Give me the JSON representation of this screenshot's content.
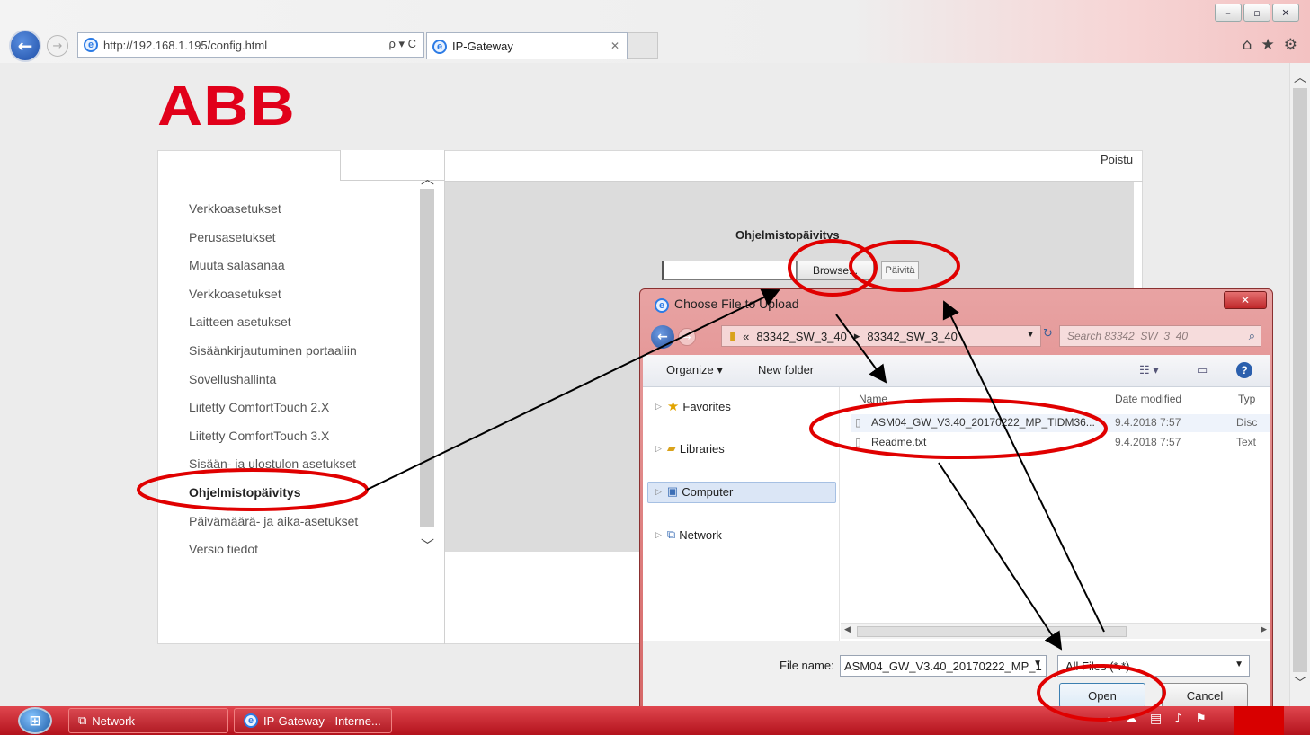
{
  "browser": {
    "url": "http://192.168.1.195/config.html",
    "tab_title": "IP-Gateway",
    "addr_tools": "ρ ▾ C",
    "win_controls": [
      "–",
      "▫",
      "✕"
    ]
  },
  "page": {
    "logo": "ABB",
    "logout": "Poistu",
    "menu": [
      "Verkkoasetukset",
      "Perusasetukset",
      "Muuta salasanaa",
      "Verkkoasetukset",
      "Laitteen asetukset",
      "Sisäänkirjautuminen portaaliin",
      "Sovellushallinta",
      "Liitetty ComfortTouch 2.X",
      "Liitetty ComfortTouch 3.X",
      "Sisään- ja ulostulon asetukset",
      "Ohjelmistopäivitys",
      "Päivämäärä- ja aika-asetukset",
      "Versio tiedot"
    ],
    "active_menu": "Ohjelmistopäivitys",
    "section_title": "Ohjelmistopäivitys",
    "browse_label": "Browse...",
    "update_label": "Päivitä"
  },
  "dialog": {
    "title": "Choose File to Upload",
    "close": "✕",
    "path": [
      "«",
      "83342_SW_3_40",
      "▸",
      "83342_SW_3_40"
    ],
    "search_placeholder": "Search 83342_SW_3_40",
    "organize": "Organize ▾",
    "new_folder": "New folder",
    "nav": [
      "Favorites",
      "Libraries",
      "Computer",
      "Network"
    ],
    "columns": [
      "Name",
      "Date modified",
      "Typ"
    ],
    "files": [
      {
        "name": "ASM04_GW_V3.40_20170222_MP_TIDM36...",
        "date": "9.4.2018 7:57",
        "type": "Disc"
      },
      {
        "name": "Readme.txt",
        "date": "9.4.2018 7:57",
        "type": "Text"
      }
    ],
    "file_name_label": "File name:",
    "file_name_value": "ASM04_GW_V3.40_20170222_MP_1",
    "file_type": "All Files (*.*)",
    "open": "Open",
    "cancel": "Cancel"
  },
  "taskbar": {
    "items": [
      "Network",
      "IP-Gateway - Interne..."
    ]
  },
  "colors": {
    "brand_red": "#e1001a",
    "annotation_red": "#e00000"
  }
}
